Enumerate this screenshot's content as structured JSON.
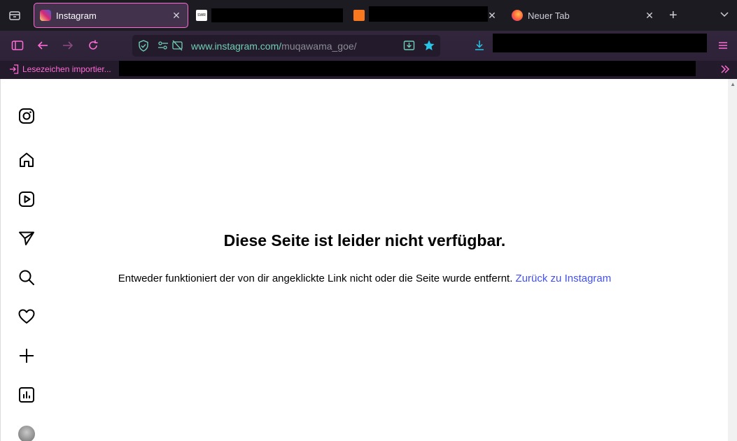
{
  "browser": {
    "tabs": [
      {
        "title": "Instagram",
        "active": true
      },
      {
        "title": "",
        "active": false
      },
      {
        "title": "",
        "active": false
      },
      {
        "title": "Neuer Tab",
        "active": false
      }
    ],
    "url": {
      "host": "www.instagram.com/",
      "path": "muqawama_goe/"
    },
    "bookmarks": {
      "import_label": "Lesezeichen importier..."
    }
  },
  "page": {
    "error_title": "Diese Seite ist leider nicht verfügbar.",
    "error_body": "Entweder funktioniert der von dir angeklickte Link nicht oder die Seite wurde entfernt.",
    "error_link": "Zurück zu Instagram"
  },
  "sidebar": {
    "items": [
      {
        "icon": "instagram-logo-icon"
      },
      {
        "icon": "home-icon"
      },
      {
        "icon": "reels-icon"
      },
      {
        "icon": "send-icon"
      },
      {
        "icon": "search-icon"
      },
      {
        "icon": "heart-icon"
      },
      {
        "icon": "create-icon"
      },
      {
        "icon": "insights-icon"
      },
      {
        "icon": "avatar"
      }
    ]
  },
  "colors": {
    "accent": "#ff6bd5",
    "link": "#4150f7",
    "url_host": "#6fcfb3",
    "toolbar": "#2d2237"
  }
}
